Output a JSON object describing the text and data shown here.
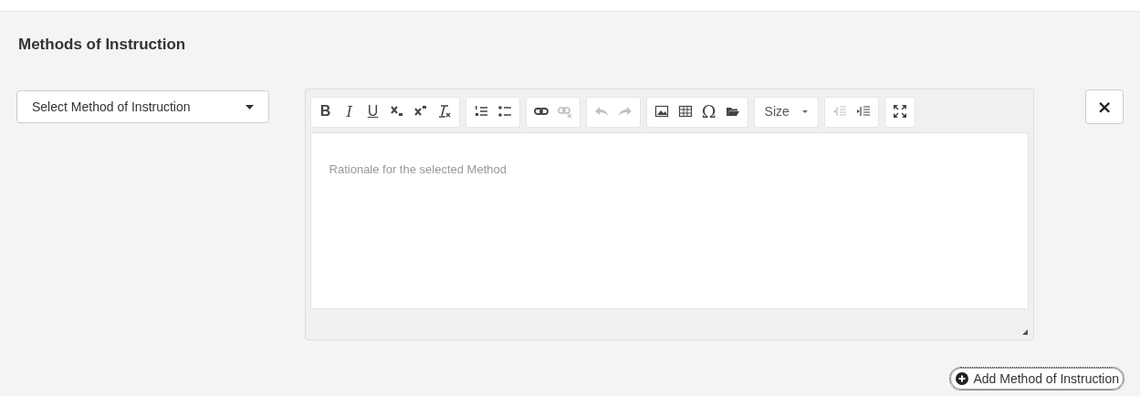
{
  "section": {
    "title": "Methods of Instruction"
  },
  "method_select": {
    "placeholder": "Select Method of Instruction"
  },
  "editor": {
    "placeholder": "Rationale for the selected Method",
    "toolbar": [
      {
        "items": [
          {
            "kind": "bold",
            "text": "B",
            "disabled": false
          },
          {
            "kind": "italic",
            "text": "I",
            "disabled": false
          },
          {
            "kind": "underline",
            "text": "U",
            "disabled": false
          },
          {
            "kind": "subscript",
            "disabled": false
          },
          {
            "kind": "superscript",
            "disabled": false
          },
          {
            "kind": "clearformat",
            "disabled": false
          }
        ]
      },
      {
        "items": [
          {
            "kind": "numbered",
            "disabled": false
          },
          {
            "kind": "bulleted",
            "disabled": false
          }
        ]
      },
      {
        "items": [
          {
            "kind": "link",
            "disabled": false
          },
          {
            "kind": "unlink",
            "disabled": true
          }
        ]
      },
      {
        "items": [
          {
            "kind": "undo",
            "disabled": true
          },
          {
            "kind": "redo",
            "disabled": true
          }
        ]
      },
      {
        "items": [
          {
            "kind": "image",
            "disabled": false
          },
          {
            "kind": "table",
            "disabled": false
          },
          {
            "kind": "symbol",
            "text": "Ω",
            "disabled": false
          },
          {
            "kind": "folder",
            "disabled": false
          }
        ]
      },
      {
        "items": [
          {
            "kind": "dropdown",
            "text": "Size",
            "disabled": false
          }
        ]
      },
      {
        "items": [
          {
            "kind": "outdent",
            "disabled": true
          },
          {
            "kind": "indent",
            "disabled": false
          }
        ]
      },
      {
        "items": [
          {
            "kind": "maximize",
            "disabled": false
          }
        ]
      }
    ]
  },
  "remove_button": {
    "icon": "×"
  },
  "add_button": {
    "label": "Add Method of Instruction",
    "focused": true
  }
}
